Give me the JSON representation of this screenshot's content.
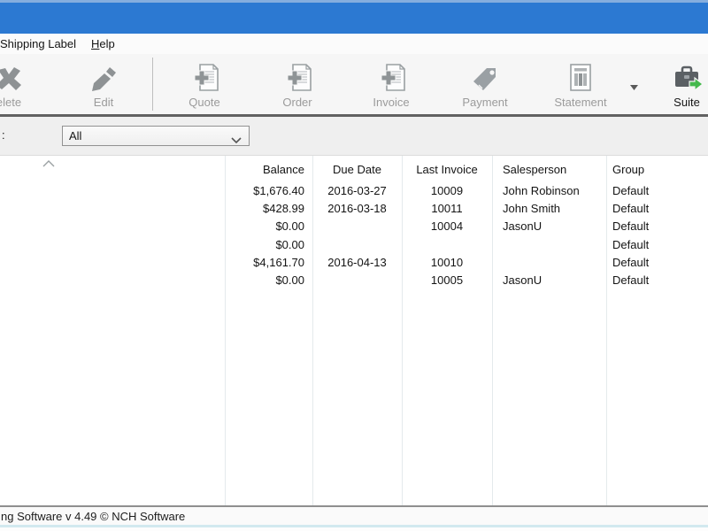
{
  "menu_bar": {
    "items": [
      "Shipping Label",
      "Help"
    ]
  },
  "toolbar": {
    "buttons": [
      {
        "label": "elete",
        "icon": "delete-x-icon",
        "enabled": false
      },
      {
        "label": "Edit",
        "icon": "edit-pencil-icon",
        "enabled": false
      },
      {
        "label": "Quote",
        "icon": "document-plus-icon",
        "enabled": false
      },
      {
        "label": "Order",
        "icon": "document-plus-icon",
        "enabled": false
      },
      {
        "label": "Invoice",
        "icon": "document-plus-icon",
        "enabled": false
      },
      {
        "label": "Payment",
        "icon": "price-tag-icon",
        "enabled": false
      },
      {
        "label": "Statement",
        "icon": "statement-document-icon",
        "enabled": false
      },
      {
        "label": "Suite",
        "icon": "suitcase-green-arrow-icon",
        "enabled": true
      }
    ],
    "statement_dropdown": "▾"
  },
  "filter": {
    "label": ":",
    "value": "All"
  },
  "table": {
    "sort": "ascending",
    "columns": [
      "Balance",
      "Due Date",
      "Last Invoice",
      "Salesperson",
      "Group"
    ],
    "rows": [
      {
        "balance": "$1,676.40",
        "due_date": "2016-03-27",
        "last_invoice": "10009",
        "salesperson": "John Robinson",
        "group": "Default"
      },
      {
        "balance": "$428.99",
        "due_date": "2016-03-18",
        "last_invoice": "10011",
        "salesperson": "John Smith",
        "group": "Default"
      },
      {
        "balance": "$0.00",
        "due_date": "",
        "last_invoice": "10004",
        "salesperson": "JasonU",
        "group": "Default"
      },
      {
        "balance": "$0.00",
        "due_date": "",
        "last_invoice": "",
        "salesperson": "",
        "group": "Default"
      },
      {
        "balance": "$4,161.70",
        "due_date": "2016-04-13",
        "last_invoice": "10010",
        "salesperson": "",
        "group": "Default"
      },
      {
        "balance": "$0.00",
        "due_date": "",
        "last_invoice": "10005",
        "salesperson": "JasonU",
        "group": "Default"
      }
    ]
  },
  "status_bar": {
    "text": "ng Software v 4.49 © NCH Software"
  },
  "colors": {
    "titlebar_blue": "#2c79d2",
    "disabled_gray": "#9b9b9b",
    "suite_arrow_green": "#45b94d",
    "toolbar_bg": "#f6f6f6",
    "filterbar_bg": "#efefef"
  }
}
